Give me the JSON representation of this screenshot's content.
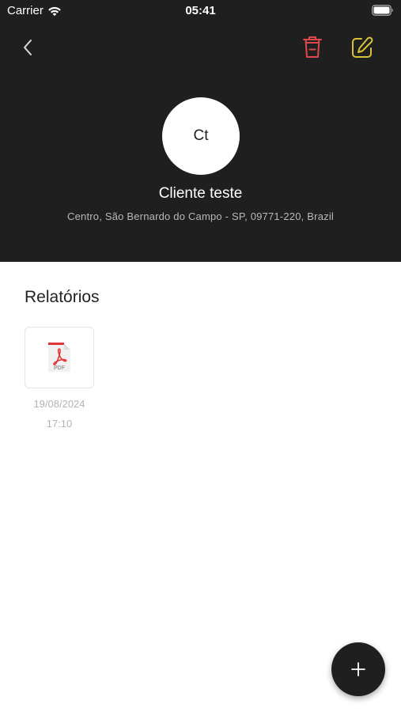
{
  "status_bar": {
    "carrier": "Carrier",
    "time": "05:41",
    "wifi_icon": "wifi-icon",
    "battery_icon": "battery-icon"
  },
  "toolbar": {
    "back_icon": "chevron-left-icon",
    "delete_icon": "trash-icon",
    "edit_icon": "pencil-icon",
    "delete_color": "#e0484a",
    "edit_color": "#d9c23a"
  },
  "client": {
    "initials": "Ct",
    "name": "Cliente teste",
    "address": "Centro, São Bernardo do Campo - SP, 09771-220, Brazil"
  },
  "reports": {
    "title": "Relatórios",
    "items": [
      {
        "icon": "pdf-file-icon",
        "file_label": "PDF",
        "date": "19/08/2024",
        "time": "17:10"
      }
    ]
  },
  "fab": {
    "icon": "plus-icon"
  },
  "colors": {
    "header_bg": "#1f1f1f",
    "pdf_red": "#e3343a"
  }
}
